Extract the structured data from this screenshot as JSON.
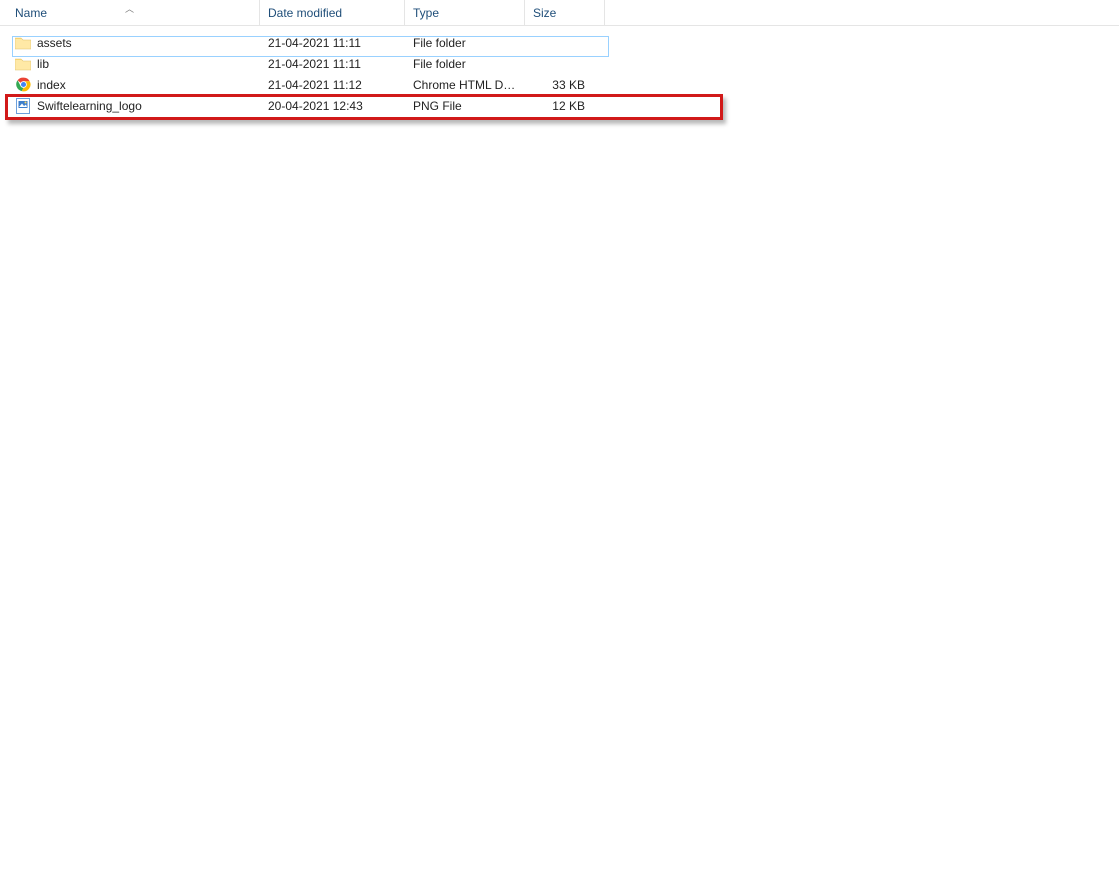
{
  "headers": {
    "name": "Name",
    "date": "Date modified",
    "type": "Type",
    "size": "Size"
  },
  "rows": [
    {
      "icon": "folder",
      "name": "assets",
      "date": "21-04-2021 11:11",
      "type": "File folder",
      "size": ""
    },
    {
      "icon": "folder",
      "name": "lib",
      "date": "21-04-2021 11:11",
      "type": "File folder",
      "size": ""
    },
    {
      "icon": "chrome",
      "name": "index",
      "date": "21-04-2021 11:12",
      "type": "Chrome HTML Do…",
      "size": "33 KB"
    },
    {
      "icon": "png",
      "name": "Swiftelearning_logo",
      "date": "20-04-2021 12:43",
      "type": "PNG File",
      "size": "12 KB"
    }
  ],
  "highlight_color": "#d11919"
}
